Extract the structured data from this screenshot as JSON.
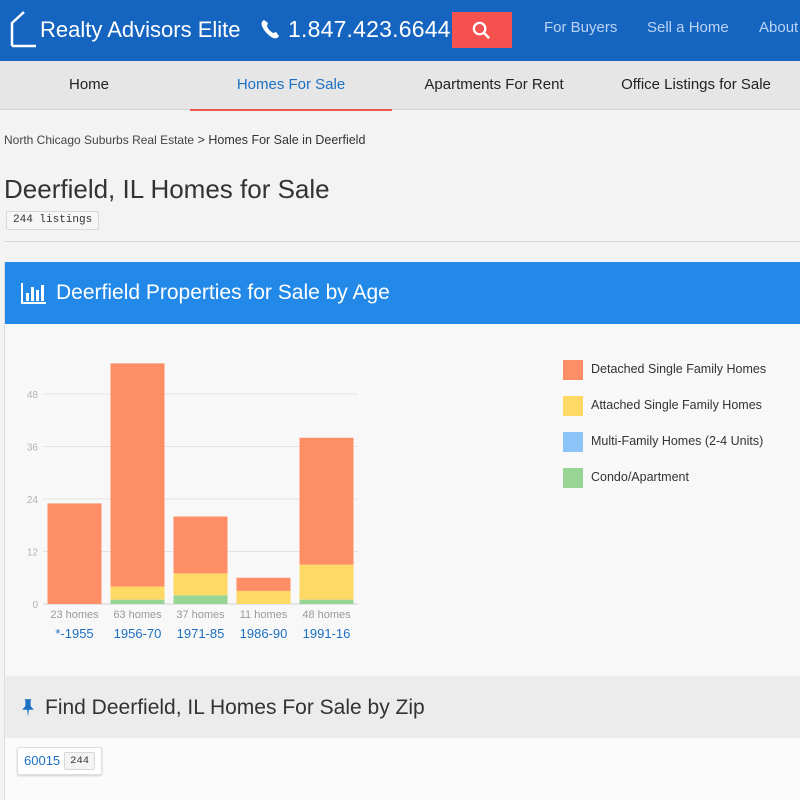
{
  "header": {
    "brand": "Realty Advisors Elite",
    "phone": "1.847.423.6644",
    "nav": [
      "For Buyers",
      "Sell a Home",
      "About"
    ],
    "icons": {
      "logo": "house-outline-icon",
      "phone": "phone-icon",
      "search": "search-icon"
    },
    "colors": {
      "bar": "#1565c0",
      "search_button": "#f4514f"
    }
  },
  "subnav": {
    "tabs": [
      {
        "label": "Home",
        "active": false
      },
      {
        "label": "Homes For Sale",
        "active": true
      },
      {
        "label": "Apartments For Rent",
        "active": false
      },
      {
        "label": "Office Listings for Sale",
        "active": false
      }
    ]
  },
  "breadcrumb": {
    "parent": "North Chicago Suburbs Real Estate",
    "separator": ">",
    "current": "Homes For Sale in Deerfield"
  },
  "page": {
    "title": "Deerfield, IL Homes for Sale",
    "listings_badge": "244 listings"
  },
  "age_section": {
    "title": "Deerfield Properties for Sale by Age",
    "icon": "bar-chart-icon",
    "header_color": "#2289e8"
  },
  "chart_data": {
    "type": "bar",
    "stacked": true,
    "categories": [
      "*-1955",
      "1956-70",
      "1971-85",
      "1986-90",
      "1991-16"
    ],
    "counts": [
      "23 homes",
      "63 homes",
      "37 homes",
      "11 homes",
      "48 homes"
    ],
    "series": [
      {
        "name": "Detached Single Family Homes",
        "color": "#fe8e66",
        "values": [
          23,
          51,
          13,
          3,
          29
        ]
      },
      {
        "name": "Attached Single Family Homes",
        "color": "#fed966",
        "values": [
          0,
          3,
          5,
          3,
          8
        ]
      },
      {
        "name": "Multi-Family Homes (2-4 Units)",
        "color": "#8cc4f7",
        "values": [
          0,
          0,
          0,
          0,
          0
        ]
      },
      {
        "name": "Condo/Apartment",
        "color": "#98d494",
        "values": [
          0,
          1,
          2,
          0,
          1
        ]
      }
    ],
    "yticks": [
      0,
      12,
      24,
      36,
      48
    ],
    "ylim": [
      0,
      60
    ],
    "grid": true,
    "legend_position": "right"
  },
  "zip_section": {
    "title": "Find Deerfield, IL Homes For Sale by Zip",
    "icon": "pushpin-icon",
    "zips": [
      {
        "code": "60015",
        "count": "244"
      }
    ]
  }
}
